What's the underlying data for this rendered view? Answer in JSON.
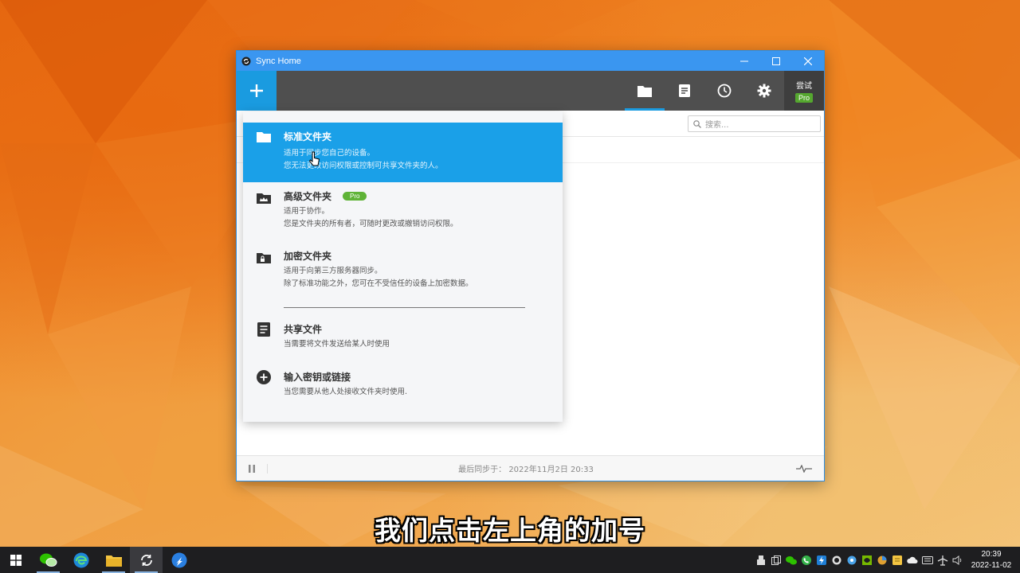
{
  "window": {
    "title": "Sync Home",
    "controls": {
      "minimize": "—",
      "maximize": "☐",
      "close": "✕"
    }
  },
  "toolbar": {
    "add_icon": "plus-icon",
    "tabs": [
      "folder-icon",
      "document-icon",
      "clock-icon",
      "gear-icon"
    ],
    "trial_label": "尝试",
    "trial_badge": "Pro"
  },
  "search": {
    "placeholder": "搜索..."
  },
  "menu": {
    "items": [
      {
        "icon": "folder-icon",
        "title": "标准文件夹",
        "desc1": "适用于同步您自己的设备。",
        "desc2": "您无法更改访问权限或控制可共享文件夹的人。"
      },
      {
        "icon": "advanced-folder-icon",
        "title": "高级文件夹",
        "badge": "Pro",
        "desc1": "适用于协作。",
        "desc2": "您是文件夹的所有者，可随时更改或撤销访问权限。"
      },
      {
        "icon": "encrypted-folder-icon",
        "title": "加密文件夹",
        "desc1": "适用于向第三方服务器同步。",
        "desc2": "除了标准功能之外，您可在不受信任的设备上加密数据。"
      },
      {
        "icon": "file-icon",
        "title": "共享文件",
        "desc1": "当需要将文件发送给某人时使用"
      },
      {
        "icon": "add-circle-icon",
        "title": "输入密钥或链接",
        "desc1": "当您需要从他人处接收文件夹时使用."
      }
    ]
  },
  "status": {
    "last_sync": "最后同步于： 2022年11月2日 20:33"
  },
  "subtitle": "我们点击左上角的加号",
  "taskbar": {
    "time": "20:39",
    "date": "2022-11-02"
  },
  "colors": {
    "accent": "#1aa0e8",
    "titlebar": "#3a96f0",
    "toolbar": "#4f4f4f",
    "pro_green": "#55a72f"
  }
}
